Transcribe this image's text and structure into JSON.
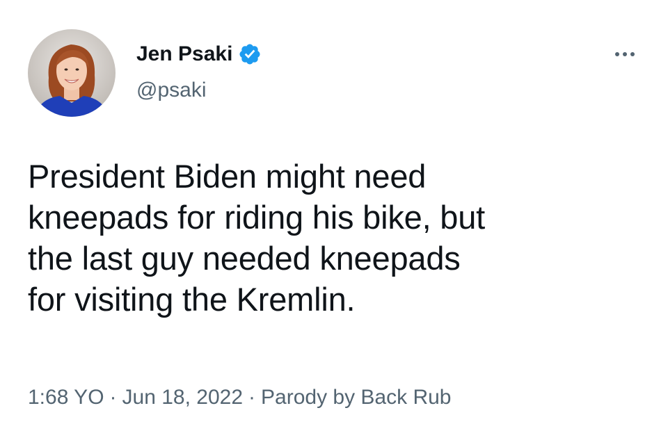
{
  "user": {
    "display_name": "Jen Psaki",
    "handle": "@psaki",
    "verified": true,
    "verified_color": "#1d9bf0"
  },
  "tweet": {
    "lines": [
      "President Biden might need",
      "kneepads for riding his bike, but",
      "the last guy needed kneepads",
      "for visiting the Kremlin."
    ]
  },
  "meta": {
    "time": "1:68 YO",
    "separator": "·",
    "date": "Jun 18, 2022",
    "source": "Parody by Back Rub"
  },
  "icons": {
    "more": "more-options-icon",
    "verified": "verified-badge-icon"
  },
  "colors": {
    "text_primary": "#0f1419",
    "text_secondary": "#536471",
    "background": "#ffffff"
  }
}
